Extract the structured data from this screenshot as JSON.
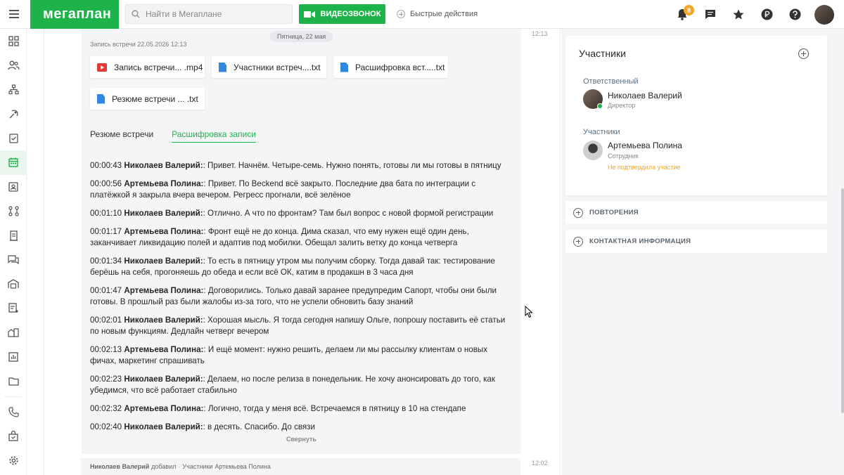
{
  "app": {
    "logo_text": "мегаплан",
    "search_placeholder": "Найти в Мегаплане",
    "video_call_label": "ВИДЕОЗВОНОК",
    "quick_actions_label": "Быстрые действия",
    "notifications_count": "8",
    "brand_color": "#1db34a"
  },
  "sidebar": {
    "items": [
      "dashboard-icon",
      "contacts-icon",
      "structure-icon",
      "deals-icon",
      "tasks-icon",
      "calendar-icon",
      "employees-icon",
      "processes-icon",
      "documents-icon",
      "chat-icon",
      "warehouse-icon",
      "invoices-icon",
      "finance-icon",
      "reports-icon",
      "files-icon",
      "telephony-icon",
      "store-icon",
      "settings-icon"
    ],
    "active": "calendar-icon"
  },
  "feed": {
    "date_pill": "Пятница, 22 мая",
    "time_top": "12:13",
    "meeting_title": "Запись встречи 22.05.2026 12:13",
    "files": [
      {
        "name": "Запись встречи... .mp4",
        "type": "mp4"
      },
      {
        "name": "Участники встреч....txt",
        "type": "txt"
      },
      {
        "name": "Расшифровка вст.....txt",
        "type": "txt"
      },
      {
        "name": "Резюме встречи ... .txt",
        "type": "txt"
      }
    ],
    "tabs": [
      {
        "label": "Резюме встречи",
        "active": false
      },
      {
        "label": "Расшифровка записи",
        "active": true
      }
    ],
    "transcript": [
      {
        "time": "00:00:43",
        "speaker": "Николаев Валерий:",
        "text": ": Привет. Начнём. Четыре-семь. Нужно понять, готовы ли мы готовы в пятницу"
      },
      {
        "time": "00:00:56",
        "speaker": "Артемьева Полина:",
        "text": ": Привет. По Beckend всё закрыто. Последние два бата по интеграции с платёжкой я закрыла вчера вечером. Регресс прогнали, всё зелёное"
      },
      {
        "time": "00:01:10",
        "speaker": "Николаев Валерий:",
        "text": ": Отлично. А что по фронтам? Там был вопрос с новой формой регистрации"
      },
      {
        "time": "00:01:17",
        "speaker": "Артемьева Полина:",
        "text": ": Фронт ещё не до конца. Дима сказал, что ему нужен ещё один день, заканчивает ликвидацию полей и адаптив под мобилки. Обещал залить ветку до конца четверга"
      },
      {
        "time": "00:01:34",
        "speaker": "Николаев Валерий:",
        "text": ": То есть в пятницу утром мы получим сборку. Тогда давай так: тестирование берёшь на себя, прогоняешь до обеда и если всё ОК, катим в продакшн в 3 часа дня"
      },
      {
        "time": "00:01:47",
        "speaker": "Артемьева Полина:",
        "text": ": Договорились. Только давай заранее предупредим Сапорт, чтобы они были готовы. В прошлый раз были жалобы из-за того, что не успели обновить базу знаний"
      },
      {
        "time": "00:02:01",
        "speaker": "Николаев Валерий:",
        "text": ": Хорошая мысль. Я тогда сегодня напишу Ольге, попрошу поставить её статьи по новым функциям. Дедлайн четверг вечером"
      },
      {
        "time": "00:02:13",
        "speaker": "Артемьева Полина:",
        "text": ": И ещё момент: нужно решить, делаем ли мы рассылку клиентам о новых фичах, маркетинг спрашивать"
      },
      {
        "time": "00:02:23",
        "speaker": "Николаев Валерий:",
        "text": ": Делаем, но после релиза в понедельник. Не хочу анонсировать до того, как убедимся, что всё работает стабильно"
      },
      {
        "time": "00:02:32",
        "speaker": "Артемьева Полина:",
        "text": ": Логично, тогда у меня всё. Встречаемся в пятницу в 10 на стендапе"
      },
      {
        "time": "00:02:40",
        "speaker": "Николаев Валерий:",
        "text": ": в десять. Спасибо. До связи"
      }
    ],
    "collapse_label": "Свернуть",
    "time_bottom": "12:02",
    "bottom_author": "Николаев Валерий",
    "bottom_action": "добавил",
    "bottom_field": "Участники",
    "bottom_value": "Артемьева Полина"
  },
  "participants": {
    "title": "Участники",
    "responsible_label": "Ответственный",
    "responsible_name": "Николаев Валерий",
    "responsible_role": "Директор",
    "members_label": "Участники",
    "member_name": "Артемьева Полина",
    "member_role": "Сотрудник",
    "member_note": "Не подтвердила участие",
    "note_color": "#f5a623"
  },
  "accordions": {
    "repeats": "ПОВТОРЕНИЯ",
    "contact_info": "КОНТАКТНАЯ ИНФОРМАЦИЯ"
  }
}
